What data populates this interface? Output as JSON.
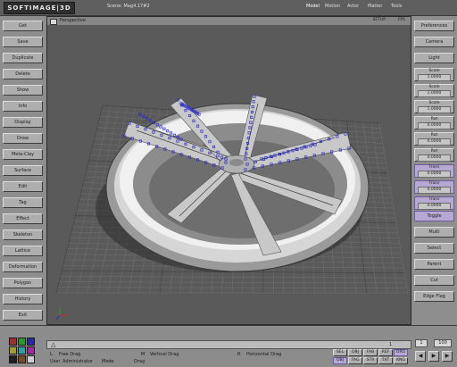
{
  "app": {
    "logo": "SOFTIMAGE|3D",
    "scene": "Scene: Mag4.17#2"
  },
  "modules": [
    "Model",
    "Motion",
    "Actor",
    "Matter",
    "Tools"
  ],
  "left_menu": [
    "Get",
    "Save",
    "Duplicate",
    "Delete",
    "Show",
    "Info",
    "Display",
    "Draw",
    "Meta-Clay",
    "Surface",
    "Edit",
    "Tag",
    "Effect",
    "Skeleton",
    "Lattice",
    "Deformation",
    "Polygon",
    "History",
    "Exit"
  ],
  "right_top": [
    "Preferences",
    "Camera",
    "Light"
  ],
  "right_values": [
    {
      "label": "Scale",
      "value": "1.0000"
    },
    {
      "label": "Scale",
      "value": "1.0000"
    },
    {
      "label": "Scale",
      "value": "1.0000"
    },
    {
      "label": "Rot",
      "value": "0.0000"
    },
    {
      "label": "Rot",
      "value": "0.0000"
    },
    {
      "label": "Rot",
      "value": "0.0000"
    },
    {
      "label": "Trans",
      "value": "0.0000"
    },
    {
      "label": "Trans",
      "value": "0.0000"
    },
    {
      "label": "Trans",
      "value": "0.0000"
    }
  ],
  "right_bottom": [
    "Toggle",
    "Multi",
    "Select",
    "Parent",
    "Cut",
    "Edge Flag"
  ],
  "viewport": {
    "name": "Perspective",
    "mode": "SETUP",
    "view": "FPS"
  },
  "status": {
    "l_label": "L",
    "l_value": "Free Drag",
    "m_label": "M",
    "m_value": "Vertical Drag",
    "r_label": "R",
    "r_value": "Horizontal Drag",
    "user_label": "User",
    "user_value": "Administrator",
    "mode_label": "Mode",
    "mode_value": "Drag"
  },
  "timeline": {
    "start": "1",
    "current": "1",
    "end": "100"
  },
  "status_buttons_top": [
    "SEL",
    "OBJ",
    "FAB",
    "REF",
    "ORG"
  ],
  "status_buttons_bottom": [
    "OBJ",
    "TAG",
    "STR",
    "TXT",
    "KNG"
  ],
  "colors": {
    "selection": "#2a2acc",
    "highlight": "#b6a8d2",
    "palette": [
      "#a03030",
      "#2a9a2a",
      "#2a2aa0",
      "#a0a02a",
      "#2aa0a0",
      "#a02aa0",
      "#202020",
      "#7a4a2a",
      "#d0d0d0"
    ]
  }
}
